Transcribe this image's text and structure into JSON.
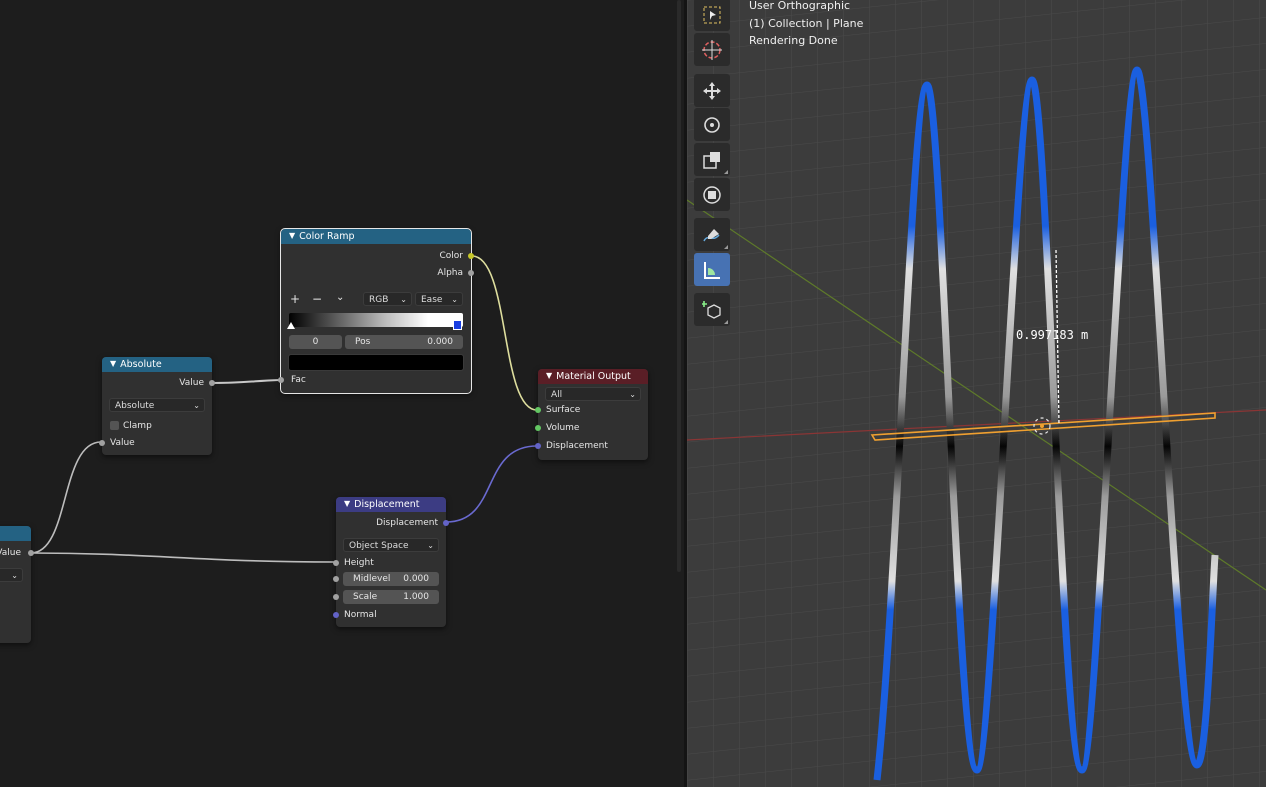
{
  "node_editor": {
    "nodes": {
      "color_ramp": {
        "title": "Color Ramp",
        "outputs": {
          "color": "Color",
          "alpha": "Alpha"
        },
        "buttons": {
          "add": "+",
          "remove": "−",
          "menu": "⌄"
        },
        "color_mode": "RGB",
        "interpolation": "Ease",
        "stop_index": "0",
        "pos_label": "Pos",
        "pos_value": "0.000",
        "input_fac": "Fac"
      },
      "absolute": {
        "title": "Absolute",
        "output_value": "Value",
        "operation": "Absolute",
        "clamp_label": "Clamp",
        "input_value": "Value"
      },
      "material_output": {
        "title": "Material Output",
        "target": "All",
        "inputs": {
          "surface": "Surface",
          "volume": "Volume",
          "displacement": "Displacement"
        }
      },
      "displacement": {
        "title": "Displacement",
        "output": "Displacement",
        "space": "Object Space",
        "height_label": "Height",
        "midlevel_label": "Midlevel",
        "midlevel_value": "0.000",
        "scale_label": "Scale",
        "scale_value": "1.000",
        "normal_label": "Normal"
      },
      "partial": {
        "output_value": "Value"
      }
    },
    "colors": {
      "header_converter": "#246283",
      "header_output": "#5a1e26",
      "header_vector": "#3c3c83",
      "socket_float": "#a1a1a1",
      "socket_color": "#c7c729",
      "socket_shader": "#63c763",
      "socket_vector": "#6363c7",
      "wire": "#c8c8c8"
    }
  },
  "viewport": {
    "overlay": {
      "view_name": "User Orthographic",
      "collection": "(1) Collection | Plane",
      "status": "Rendering Done"
    },
    "toolbar": [
      "select-box-icon",
      "cursor-icon",
      "move-icon",
      "rotate-icon",
      "scale-icon",
      "transform-icon",
      "annotate-icon",
      "measure-icon",
      "add-cube-icon"
    ],
    "measurement": "0.997183 m",
    "colors": {
      "grid_bg": "#3c3c3c",
      "x_axis": "#8a3535",
      "y_axis": "#5e7a2a",
      "wave_blue": "#1a5fe0",
      "selection": "#f0a030"
    }
  }
}
